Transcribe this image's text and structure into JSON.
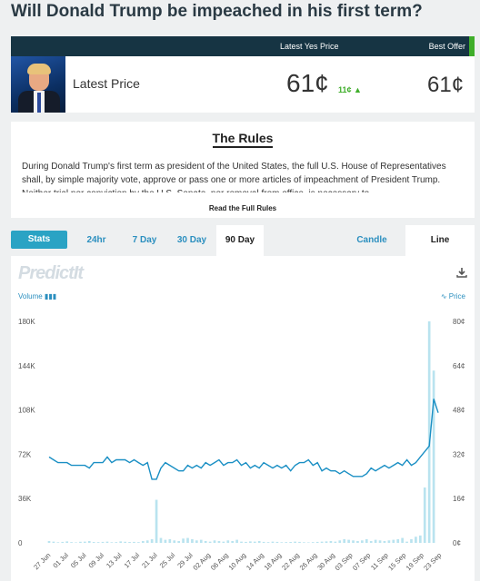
{
  "market": {
    "question": "Will Donald Trump be impeached in his first term?"
  },
  "price_header": {
    "latest_yes_label": "Latest Yes Price",
    "best_offer_label": "Best Offer",
    "latest_label": "Latest Price",
    "latest_yes_price": "61¢",
    "change": "11¢",
    "best_offer_price": "61¢",
    "change_color": "#3fae2a"
  },
  "rules": {
    "title": "The Rules",
    "text": "During Donald Trump's first term as president of the United States, the full U.S. House of Representatives shall, by simple majority vote, approve or pass one or more articles of impeachment of President Trump. Neither trial nor conviction by the U.S. Senate, nor removal from office, is necessary to",
    "read_more": "Read the Full Rules"
  },
  "tabs": {
    "stats": "Stats",
    "ranges": [
      "24hr",
      "7 Day",
      "30 Day",
      "90 Day"
    ],
    "active_range": "90 Day",
    "candle": "Candle",
    "line": "Line"
  },
  "chart_header": {
    "logo": "PredictIt",
    "volume_label": "Volume",
    "price_label": "Price"
  },
  "chart_data": {
    "type": "line",
    "left_axis_ticks": [
      "180K",
      "144K",
      "108K",
      "72K",
      "36K",
      "0"
    ],
    "right_axis_ticks": [
      "80¢",
      "64¢",
      "48¢",
      "32¢",
      "16¢",
      "0¢"
    ],
    "volume_ylim": [
      0,
      180000
    ],
    "price_ylim": [
      0,
      80
    ],
    "x_labels": [
      "27 Jun",
      "01 Jul",
      "05 Jul",
      "09 Jul",
      "13 Jul",
      "17 Jul",
      "21 Jul",
      "25 Jul",
      "29 Jul",
      "02 Aug",
      "06 Aug",
      "10 Aug",
      "14 Aug",
      "18 Aug",
      "22 Aug",
      "26 Aug",
      "30 Aug",
      "03 Sep",
      "07 Sep",
      "11 Sep",
      "15 Sep",
      "19 Sep",
      "23 Sep"
    ],
    "series": [
      {
        "name": "Price",
        "values": [
          31,
          30,
          29,
          29,
          29,
          28,
          28,
          28,
          28,
          27,
          29,
          29,
          29,
          31,
          29,
          30,
          30,
          30,
          29,
          30,
          29,
          28,
          29,
          23,
          23,
          27,
          29,
          28,
          27,
          26,
          26,
          28,
          27,
          28,
          27,
          29,
          28,
          29,
          30,
          28,
          29,
          29,
          30,
          28,
          29,
          27,
          28,
          27,
          29,
          28,
          27,
          28,
          27,
          28,
          26,
          28,
          29,
          29,
          30,
          28,
          29,
          26,
          27,
          26,
          26,
          25,
          26,
          25,
          24,
          24,
          24,
          25,
          27,
          26,
          27,
          28,
          27,
          28,
          29,
          28,
          30,
          28,
          29,
          31,
          33,
          35,
          52,
          47
        ]
      },
      {
        "name": "Volume",
        "values": [
          1500,
          1000,
          500,
          800,
          1200,
          600,
          400,
          900,
          1000,
          1500,
          700,
          600,
          800,
          1000,
          500,
          600,
          1200,
          900,
          700,
          800,
          600,
          1500,
          2000,
          3000,
          35000,
          4000,
          2500,
          3000,
          2000,
          1500,
          3500,
          4000,
          3000,
          2000,
          2500,
          1500,
          1000,
          2000,
          1500,
          1000,
          2000,
          1500,
          2500,
          1000,
          800,
          1200,
          1000,
          1500,
          800,
          600,
          1000,
          800,
          500,
          600,
          700,
          1000,
          800,
          500,
          400,
          600,
          800,
          1000,
          1200,
          1500,
          1000,
          2000,
          3000,
          2500,
          2000,
          1500,
          2000,
          3000,
          1500,
          2500,
          2000,
          1500,
          2000,
          2500,
          3000,
          4000,
          1000,
          3000,
          5000,
          6000,
          45000,
          180000,
          140000
        ]
      }
    ],
    "grid": false,
    "line_color": "#1a8fc4",
    "bar_color": "#b9e3ef"
  }
}
